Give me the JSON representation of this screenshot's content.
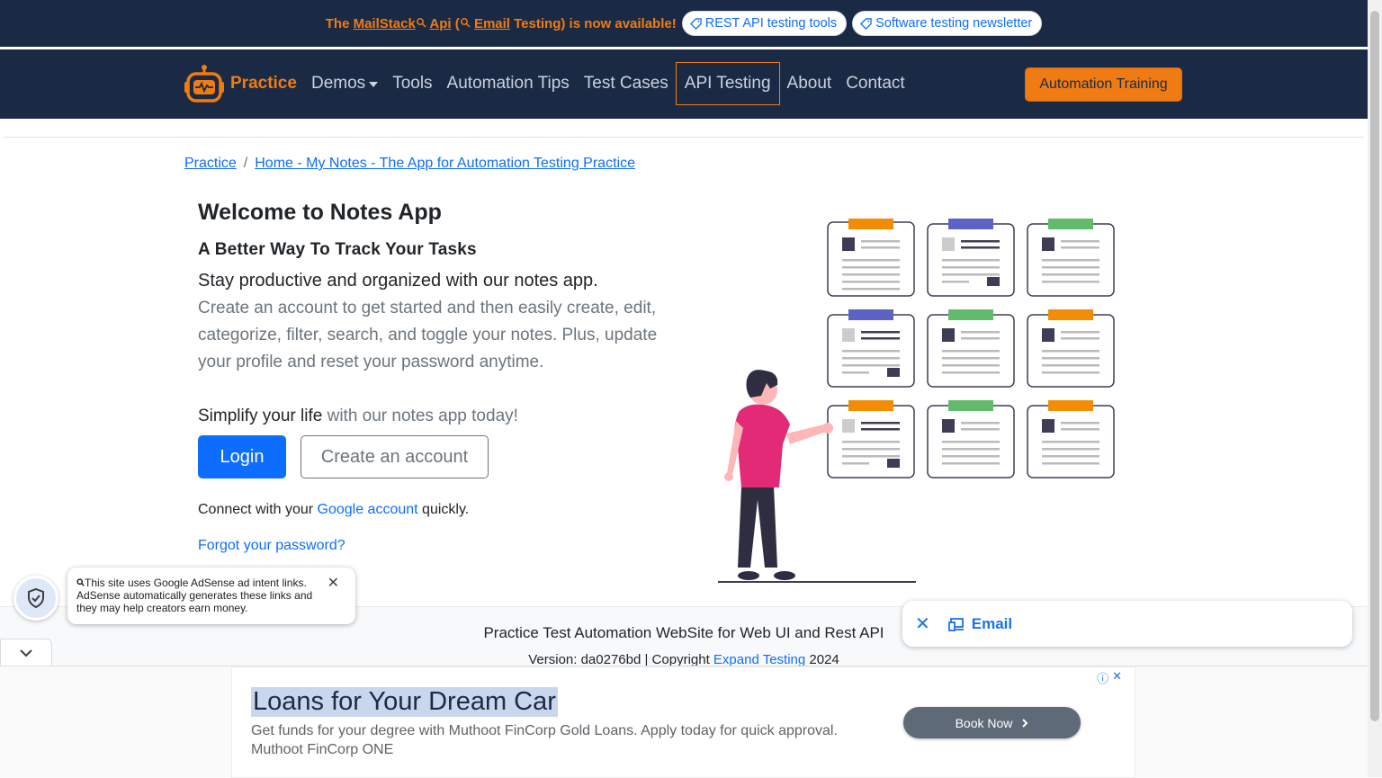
{
  "topbar": {
    "announce_prefix": "The ",
    "announce_brand": "MailStack",
    "announce_api": "Api",
    "announce_open": " (",
    "announce_email": "Email",
    "announce_rest": " Testing) is now available!",
    "pill_rest": "REST API testing tools",
    "pill_newsletter": "Software testing newsletter"
  },
  "nav": {
    "brand": "Practice",
    "links": [
      "Demos",
      "Tools",
      "Automation Tips",
      "Test Cases",
      "API Testing",
      "About",
      "Contact"
    ],
    "training": "Automation Training"
  },
  "breadcrumb": {
    "root": "Practice",
    "separator": "/",
    "current": "Home - My Notes - The App for Automation Testing Practice"
  },
  "content": {
    "title": "Welcome to Notes App",
    "subtitle": "A Better Way To Track Your Tasks",
    "lead": "Stay productive and organized with our notes app.",
    "body": "Create an account to get started and then easily create, edit, categorize, filter, search, and toggle your notes. Plus, update your profile and reset your password anytime.",
    "simplify_strong": "Simplify your life",
    "simplify_rest": " with our notes app today!",
    "login": "Login",
    "create": "Create an account",
    "connect_prefix": "Connect with your ",
    "connect_link": "Google account",
    "connect_suffix": " quickly.",
    "forgot": "Forgot your password?"
  },
  "footer": {
    "title": "Practice Test Automation WebSite for Web UI and Rest API",
    "version_prefix": "Version: da0276bd | Copyright ",
    "version_link": "Expand Testing",
    "version_year": " 2024"
  },
  "adsense_notice": {
    "text": "This site uses Google AdSense ad intent links. AdSense automatically generates these links and they may help creators earn money.",
    "close": "✕"
  },
  "email_chip": {
    "close": "✕",
    "label": "Email"
  },
  "ad": {
    "title": "Loans for Your Dream Car",
    "description": "Get funds for your degree with Muthoot FinCorp Gold Loans. Apply today for quick approval. Muthoot FinCorp ONE",
    "button": "Book Now",
    "info": "ⓘ",
    "close": "✕"
  },
  "colors": {
    "navy": "#1b2a44",
    "accent_orange": "#f07b13",
    "primary_blue": "#0d6efd"
  }
}
